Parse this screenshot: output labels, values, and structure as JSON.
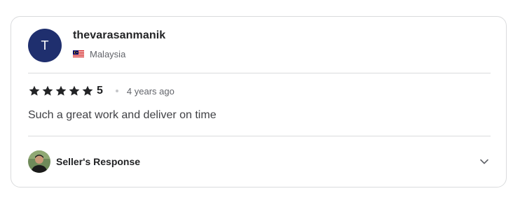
{
  "review": {
    "avatar_initial": "T",
    "username": "thevarasanmanik",
    "country": "Malaysia",
    "rating": 5,
    "rating_label": "5",
    "timestamp": "4 years ago",
    "text": "Such a great work and deliver on time"
  },
  "seller_response": {
    "label": "Seller's Response"
  },
  "icons": {
    "flag": "malaysia-flag-icon",
    "star": "star-icon",
    "chevron": "chevron-down-icon"
  },
  "colors": {
    "avatar_bg": "#1f2f6e",
    "star": "#222325",
    "text_primary": "#222325",
    "text_secondary": "#62646a",
    "border": "#dadbdd"
  }
}
